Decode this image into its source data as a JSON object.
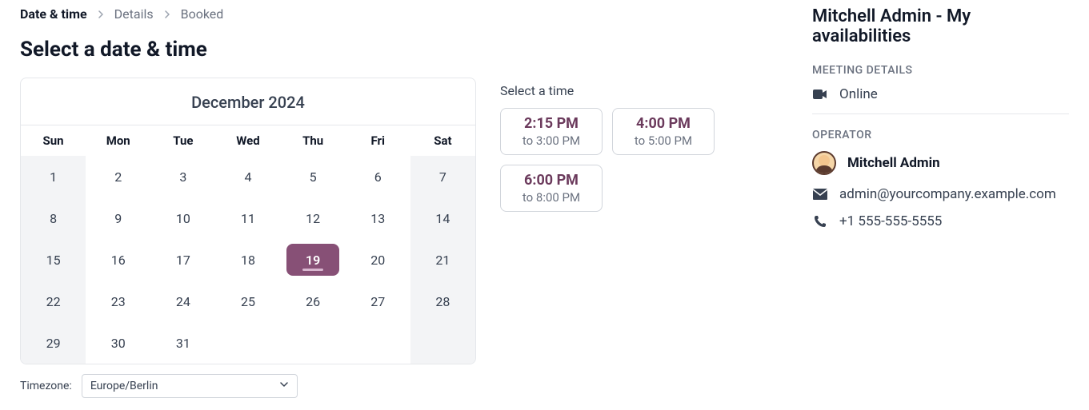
{
  "breadcrumb": {
    "items": [
      {
        "label": "Date & time",
        "active": true
      },
      {
        "label": "Details",
        "active": false
      },
      {
        "label": "Booked",
        "active": false
      }
    ]
  },
  "heading": "Select a date & time",
  "calendar": {
    "month_label": "December 2024",
    "weekdays": [
      "Sun",
      "Mon",
      "Tue",
      "Wed",
      "Thu",
      "Fri",
      "Sat"
    ],
    "cells": [
      {
        "day": 1,
        "col": 0
      },
      {
        "day": 2,
        "col": 1
      },
      {
        "day": 3,
        "col": 2
      },
      {
        "day": 4,
        "col": 3
      },
      {
        "day": 5,
        "col": 4
      },
      {
        "day": 6,
        "col": 5
      },
      {
        "day": 7,
        "col": 6
      },
      {
        "day": 8,
        "col": 0
      },
      {
        "day": 9,
        "col": 1
      },
      {
        "day": 10,
        "col": 2
      },
      {
        "day": 11,
        "col": 3
      },
      {
        "day": 12,
        "col": 4
      },
      {
        "day": 13,
        "col": 5
      },
      {
        "day": 14,
        "col": 6
      },
      {
        "day": 15,
        "col": 0
      },
      {
        "day": 16,
        "col": 1
      },
      {
        "day": 17,
        "col": 2
      },
      {
        "day": 18,
        "col": 3
      },
      {
        "day": 19,
        "col": 4,
        "selected": true
      },
      {
        "day": 20,
        "col": 5
      },
      {
        "day": 21,
        "col": 6
      },
      {
        "day": 22,
        "col": 0
      },
      {
        "day": 23,
        "col": 1
      },
      {
        "day": 24,
        "col": 2
      },
      {
        "day": 25,
        "col": 3
      },
      {
        "day": 26,
        "col": 4
      },
      {
        "day": 27,
        "col": 5
      },
      {
        "day": 28,
        "col": 6
      },
      {
        "day": 29,
        "col": 0
      },
      {
        "day": 30,
        "col": 1
      },
      {
        "day": 31,
        "col": 2
      },
      {
        "day": null,
        "col": 3
      },
      {
        "day": null,
        "col": 4
      },
      {
        "day": null,
        "col": 5
      },
      {
        "day": null,
        "col": 6
      }
    ]
  },
  "timezone": {
    "label": "Timezone:",
    "value": "Europe/Berlin"
  },
  "times": {
    "heading": "Select a time",
    "slots": [
      {
        "start": "2:15 PM",
        "end": "to 3:00 PM"
      },
      {
        "start": "4:00 PM",
        "end": "to 5:00 PM"
      },
      {
        "start": "6:00 PM",
        "end": "to 8:00 PM"
      }
    ]
  },
  "side": {
    "title": "Mitchell Admin - My availabilities",
    "meeting_details_label": "MEETING DETAILS",
    "online": "Online",
    "operator_label": "OPERATOR",
    "operator_name": "Mitchell Admin",
    "email": "admin@yourcompany.example.com",
    "phone": "+1 555-555-5555"
  }
}
